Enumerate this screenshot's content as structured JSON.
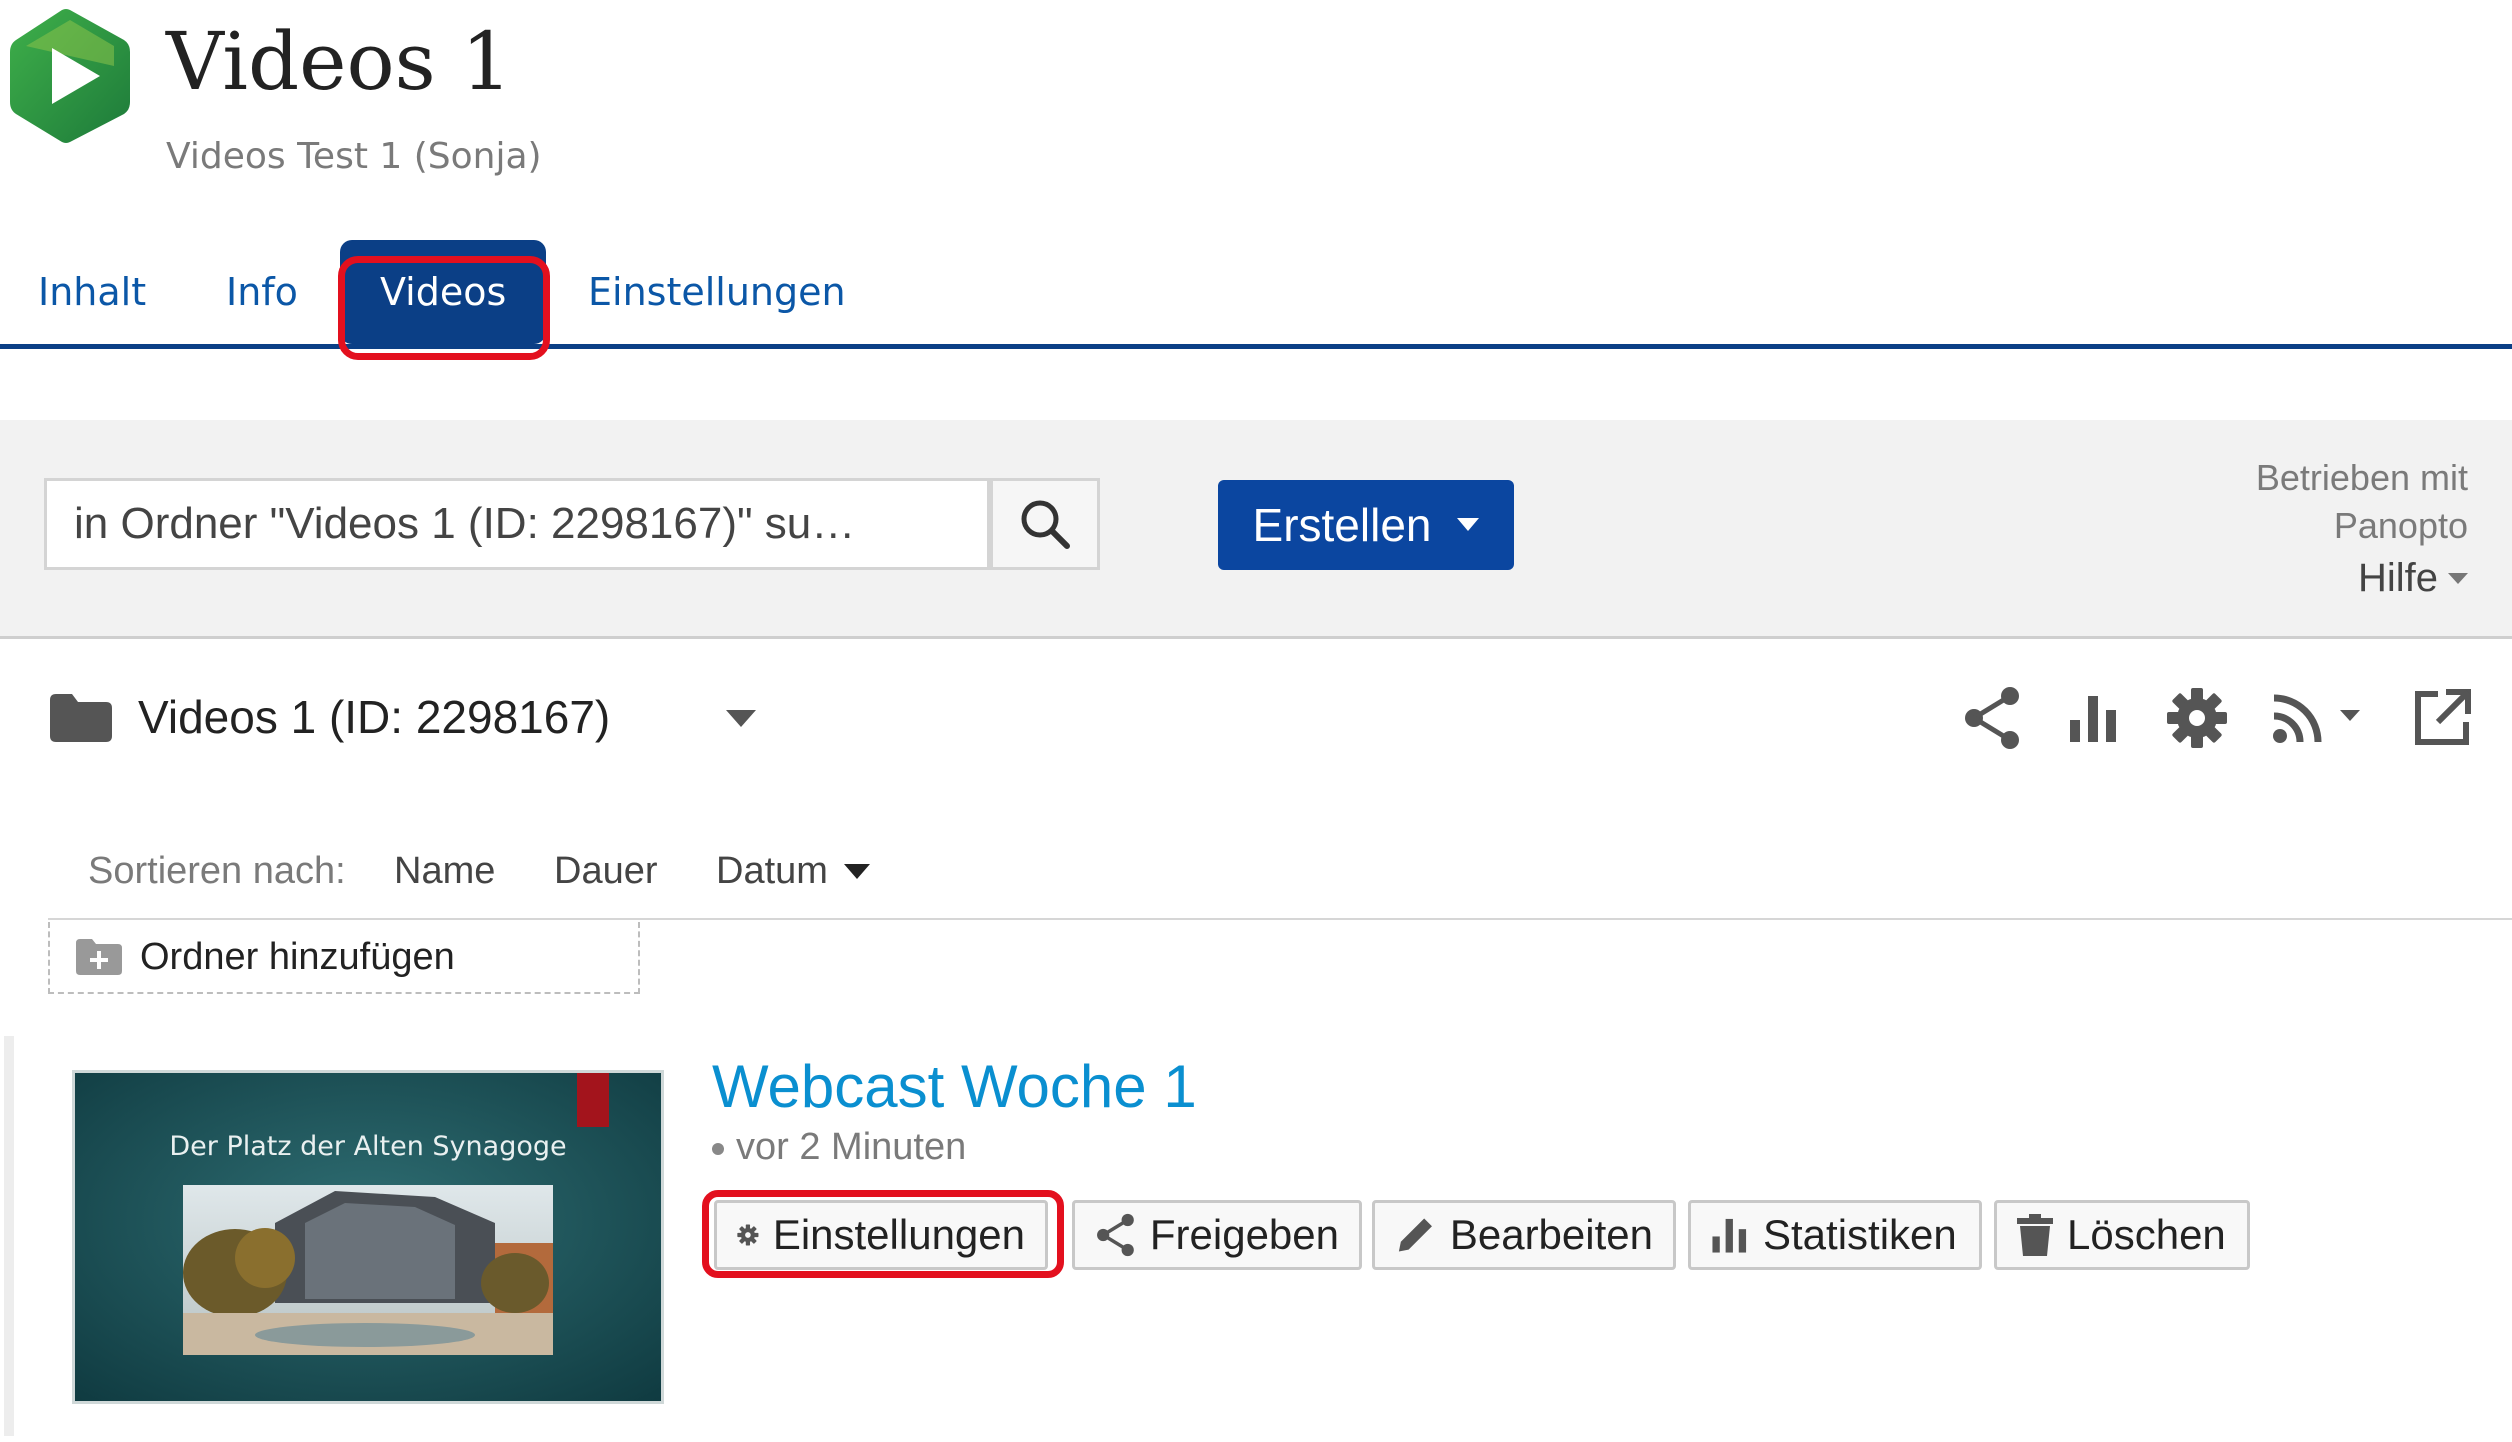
{
  "header": {
    "title": "Videos 1",
    "subtitle": "Videos Test 1 (Sonja)"
  },
  "tabs": [
    {
      "label": "Inhalt",
      "active": false
    },
    {
      "label": "Info",
      "active": false
    },
    {
      "label": "Videos",
      "active": true
    },
    {
      "label": "Einstellungen",
      "active": false
    }
  ],
  "toolbar": {
    "search_placeholder": "in Ordner \"Videos 1 (ID: 2298167)\" su…",
    "create_label": "Erstellen",
    "powered_by": "Betrieben mit Panopto",
    "help_label": "Hilfe"
  },
  "folder": {
    "name": "Videos 1 (ID: 2298167)",
    "tool_icons": [
      "share-icon",
      "stats-icon",
      "settings-icon",
      "rss-icon",
      "external-link-icon"
    ]
  },
  "sort": {
    "label": "Sortieren nach:",
    "options": [
      "Name",
      "Dauer",
      "Datum"
    ],
    "active": "Datum"
  },
  "add_folder_label": "Ordner hinzufügen",
  "session": {
    "title": "Webcast Woche 1",
    "time": "vor 2 Minuten",
    "thumbnail_title": "Der Platz der Alten Synagoge",
    "actions": [
      "Einstellungen",
      "Freigeben",
      "Bearbeiten",
      "Statistiken",
      "Löschen"
    ]
  },
  "colors": {
    "brand_blue": "#0b3f86",
    "create_blue": "#0b46a0",
    "link_blue": "#0a8fd0",
    "highlight_red": "#e3101e"
  }
}
